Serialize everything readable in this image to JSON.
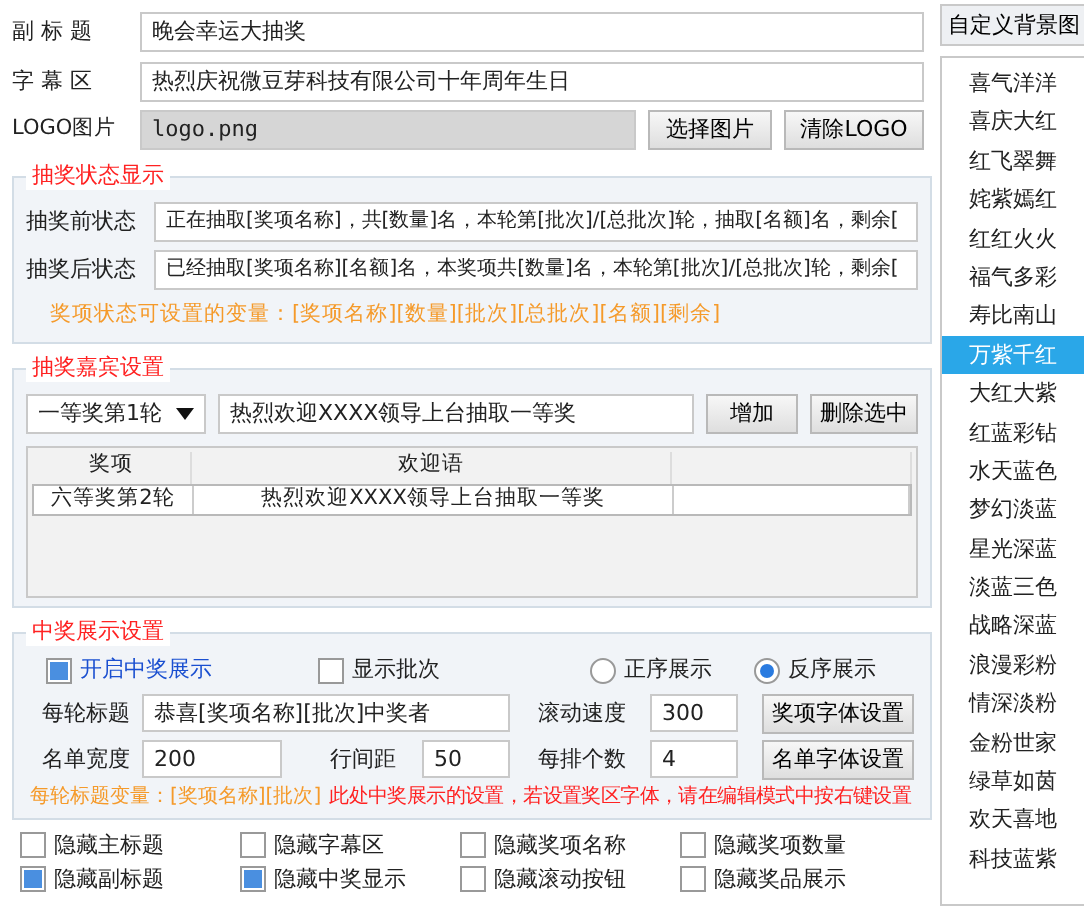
{
  "top_fields": [
    {
      "label": "副 标 题",
      "value": "晚会幸运大抽奖"
    },
    {
      "label": "字 幕 区",
      "value": "热烈庆祝微豆芽科技有限公司十年周年生日"
    }
  ],
  "logo": {
    "label": "LOGO图片",
    "value": "logo.png",
    "buttons": [
      "选择图片",
      "清除LOGO"
    ]
  },
  "status_group": {
    "title": "抽奖状态显示",
    "rows": [
      {
        "label": "抽奖前状态",
        "value": "正在抽取[奖项名称]，共[数量]名，本轮第[批次]/[总批次]轮，抽取[名额]名，剩余["
      },
      {
        "label": "抽奖后状态",
        "value": "已经抽取[奖项名称][名额]名，本奖项共[数量]名，本轮第[批次]/[总批次]轮，剩余["
      }
    ],
    "hint": "奖项状态可设置的变量：[奖项名称][数量][批次][总批次][名额][剩余]"
  },
  "guest_group": {
    "title": "抽奖嘉宾设置",
    "select": "一等奖第1轮",
    "greeting": "热烈欢迎XXXX领导上台抽取一等奖",
    "buttons": [
      "增加",
      "删除选中"
    ],
    "table": {
      "columns": [
        "奖项",
        "欢迎语"
      ],
      "rows": [
        {
          "cells": [
            "六等奖第2轮",
            "热烈欢迎XXXX领导上台抽取一等奖"
          ],
          "selected": false
        }
      ]
    }
  },
  "display_group": {
    "title": "中奖展示设置",
    "enable": {
      "label": "开启中奖展示",
      "checked": true
    },
    "show_batch": {
      "label": "显示批次",
      "checked": false
    },
    "order": [
      {
        "label": "正序展示",
        "selected": false
      },
      {
        "label": "反序展示",
        "selected": true
      }
    ],
    "title_field": {
      "label": "每轮标题",
      "value": "恭喜[奖项名称][批次]中奖者"
    },
    "speed": {
      "label": "滚动速度",
      "value": "300"
    },
    "prize_font_button": "奖项字体设置",
    "width_field": {
      "label": "名单宽度",
      "value": "200"
    },
    "spacing": {
      "label": "行间距",
      "value": "50"
    },
    "per_row": {
      "label": "每排个数",
      "value": "4"
    },
    "list_font_button": "名单字体设置",
    "hint": "每轮标题变量：[奖项名称][批次]",
    "note": "此处中奖展示的设置，若设置奖区字体，请在编辑模式中按右键设置"
  },
  "hide_options": [
    {
      "label": "隐藏主标题",
      "checked": false
    },
    {
      "label": "隐藏字幕区",
      "checked": false
    },
    {
      "label": "隐藏奖项名称",
      "checked": false
    },
    {
      "label": "隐藏奖项数量",
      "checked": false
    },
    {
      "label": "隐藏副标题",
      "checked": true
    },
    {
      "label": "隐藏中奖显示",
      "checked": true
    },
    {
      "label": "隐藏滚动按钮",
      "checked": false
    },
    {
      "label": "隐藏奖品展示",
      "checked": false
    }
  ],
  "sidebar": {
    "button": "自定义背景图",
    "themes": [
      {
        "label": "喜气洋洋",
        "selected": false
      },
      {
        "label": "喜庆大红",
        "selected": false
      },
      {
        "label": "红飞翠舞",
        "selected": false
      },
      {
        "label": "姹紫嫣红",
        "selected": false
      },
      {
        "label": "红红火火",
        "selected": false
      },
      {
        "label": "福气多彩",
        "selected": false
      },
      {
        "label": "寿比南山",
        "selected": false
      },
      {
        "label": "万紫千红",
        "selected": true
      },
      {
        "label": "大红大紫",
        "selected": false
      },
      {
        "label": "红蓝彩钻",
        "selected": false
      },
      {
        "label": "水天蓝色",
        "selected": false
      },
      {
        "label": "梦幻淡蓝",
        "selected": false
      },
      {
        "label": "星光深蓝",
        "selected": false
      },
      {
        "label": "淡蓝三色",
        "selected": false
      },
      {
        "label": "战略深蓝",
        "selected": false
      },
      {
        "label": "浪漫彩粉",
        "selected": false
      },
      {
        "label": "情深淡粉",
        "selected": false
      },
      {
        "label": "金粉世家",
        "selected": false
      },
      {
        "label": "绿草如茵",
        "selected": false
      },
      {
        "label": "欢天喜地",
        "selected": false
      },
      {
        "label": "科技蓝紫",
        "selected": false
      }
    ]
  }
}
